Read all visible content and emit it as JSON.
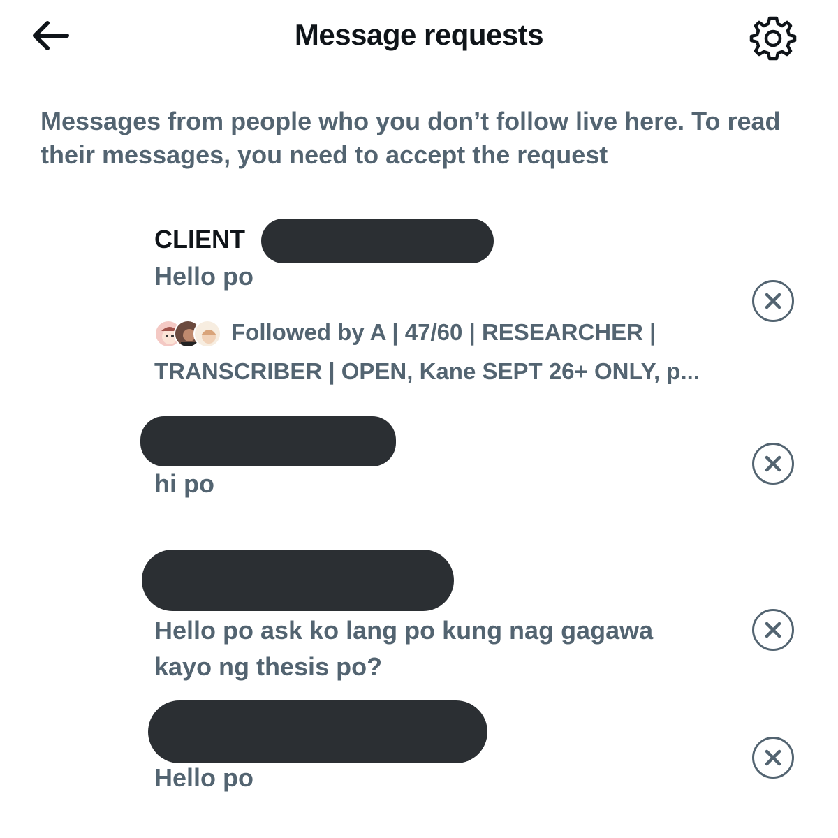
{
  "header": {
    "title": "Message requests"
  },
  "description": "Messages from people who you don’t follow live here. To read their messages, you need to accept the request",
  "requests": [
    {
      "name_visible": "CLIENT",
      "message": "Hello po",
      "followed_by": "Followed by A | 47/60 | RESEARCHER | TRANSCRIBER | OPEN, Kane SEPT 26+ ONLY, p..."
    },
    {
      "message": "hi po"
    },
    {
      "message": "Hello po ask ko lang po kung nag gagawa kayo ng thesis po?"
    },
    {
      "message": "Hello po"
    }
  ],
  "colors": {
    "primary_text": "#0f1419",
    "secondary_text": "#536471",
    "redaction": "#2b2f33",
    "background": "#ffffff"
  },
  "icons": {
    "back": "arrow-left-icon",
    "settings": "gear-icon",
    "dismiss": "close-circle-icon"
  }
}
